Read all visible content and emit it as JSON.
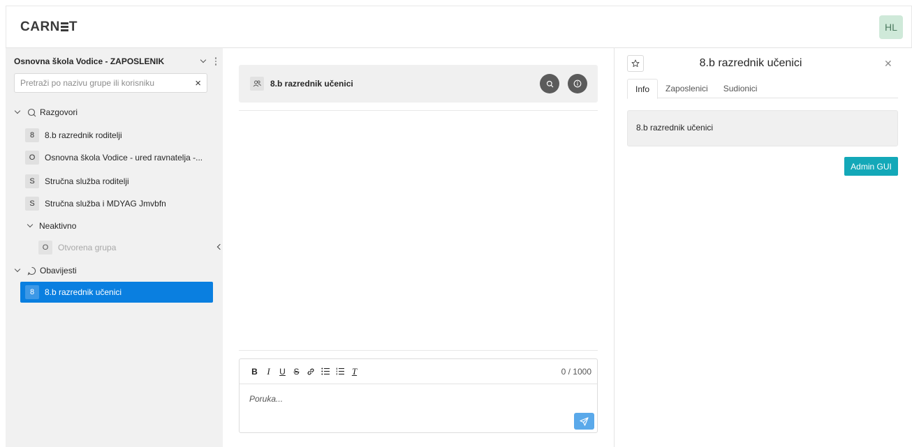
{
  "header": {
    "logo": "CARNET",
    "logo_left": "CARN",
    "logo_right": "T",
    "avatar": "HL"
  },
  "sidebar": {
    "school": "Osnovna škola Vodice - ZAPOSLENIK",
    "search": {
      "placeholder": "Pretraži po nazivu grupe ili korisniku",
      "value": ""
    },
    "sections": {
      "razgovori": {
        "label": "Razgovori",
        "items": [
          {
            "badge": "8",
            "label": "8.b razrednik roditelji"
          },
          {
            "badge": "O",
            "label": "Osnovna škola Vodice - ured ravnatelja -..."
          },
          {
            "badge": "S",
            "label": "Stručna služba roditelji"
          },
          {
            "badge": "S",
            "label": "Stručna služba i MDYAG Jmvbfn"
          }
        ]
      },
      "neaktivno": {
        "label": "Neaktivno",
        "items": [
          {
            "badge": "O",
            "label": "Otvorena grupa"
          }
        ]
      },
      "obavijesti": {
        "label": "Obavijesti",
        "items": [
          {
            "badge": "8",
            "label": "8.b razrednik učenici"
          }
        ]
      }
    }
  },
  "chat": {
    "title": "8.b razrednik učenici",
    "editor": {
      "tools": {
        "bold": "B",
        "italic": "I",
        "underline": "U",
        "strike": "S",
        "clear": "T"
      },
      "counter": "0 / 1000",
      "placeholder": "Poruka..."
    }
  },
  "panel": {
    "title": "8.b razrednik učenici",
    "tabs": [
      "Info",
      "Zaposlenici",
      "Sudionici"
    ],
    "info_text": "8.b razrednik učenici",
    "admin_button": "Admin GUI"
  },
  "colors": {
    "accent": "#0a7fe0",
    "admin": "#13a8b8",
    "send": "#5aa9ea",
    "round_button": "#5b5b5b"
  }
}
